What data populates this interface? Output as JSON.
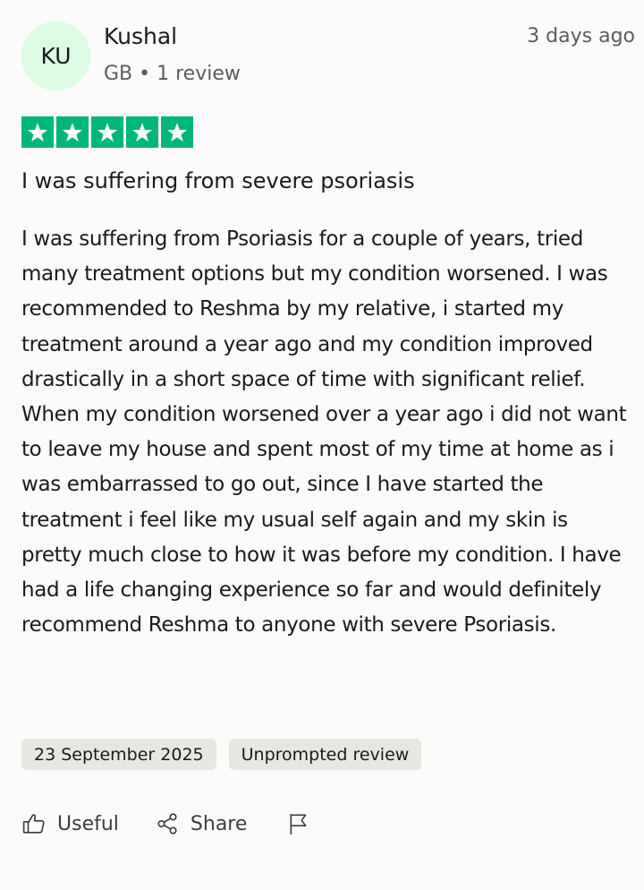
{
  "reviewer": {
    "initials": "KU",
    "name": "Kushal",
    "country": "GB",
    "separator": "•",
    "review_count": "1 review",
    "posted_ago": "3 days ago"
  },
  "rating": {
    "stars": 5,
    "max_stars": 5,
    "star_color": "#00b67a"
  },
  "review": {
    "title": "I was suffering from severe psoriasis",
    "body": "I was suffering from Psoriasis for a couple of years, tried many treatment options but my condition worsened. I was recommended to Reshma by my relative, i started my treatment around a year ago and my condition improved drastically in a short space of time with significant relief. When my condition worsened over a year ago i did not want to leave my house and spent most of my time at home as i was embarrassed to go out, since I have started the treatment i feel like my usual self again and my skin is pretty much close to how it was before my condition. I have had a life changing experience so far and would definitely recommend Reshma to anyone with severe Psoriasis."
  },
  "tags": {
    "date": "23 September 2025",
    "type": "Unprompted review"
  },
  "actions": {
    "useful_label": "Useful",
    "useful_icon": "thumbs-up-icon",
    "share_label": "Share",
    "share_icon": "share-icon",
    "report_icon": "flag-icon"
  }
}
